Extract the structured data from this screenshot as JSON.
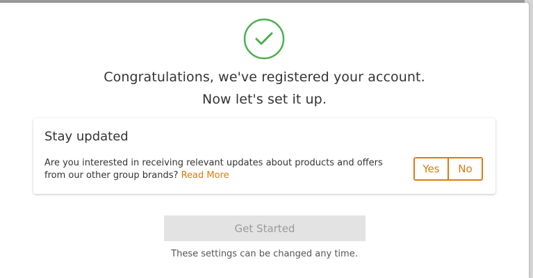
{
  "colors": {
    "accent": "#dd7a0c",
    "success": "#4caf50",
    "disabled_bg": "#e3e3e3",
    "disabled_text": "#9a9a9a"
  },
  "header": {
    "icon": "check-circle-icon",
    "line1": "Congratulations, we've registered your account.",
    "line2": "Now let's set it up."
  },
  "card": {
    "title": "Stay updated",
    "text": "Are you interested in receiving relevant updates about products and offers from our other group brands?",
    "read_more": "Read More",
    "yes_label": "Yes",
    "no_label": "No"
  },
  "footer": {
    "get_started_label": "Get Started",
    "get_started_state": "disabled",
    "note": "These settings can be changed any time."
  }
}
